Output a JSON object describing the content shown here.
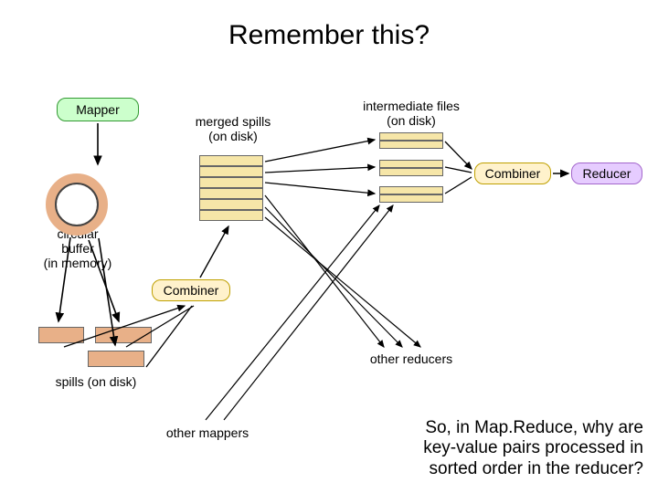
{
  "title": "Remember this?",
  "nodes": {
    "mapper": "Mapper",
    "combiner1": "Combiner",
    "combiner2": "Combiner",
    "reducer": "Reducer"
  },
  "labels": {
    "merged_spills": "merged spills\n(on disk)",
    "intermediate": "intermediate files\n(on disk)",
    "circular_buffer": "circular\nbuffer\n(in memory)",
    "spills": "spills (on disk)",
    "other_mappers": "other mappers",
    "other_reducers": "other reducers"
  },
  "footer": "So, in Map.Reduce, why are key-value pairs processed in sorted order in the reducer?"
}
